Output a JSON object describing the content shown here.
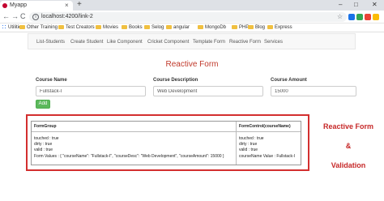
{
  "browser": {
    "tab_title": "Myapp",
    "tab_close": "×",
    "new_tab": "+",
    "window_controls": [
      "–",
      "□",
      "✕"
    ],
    "url": "localhost:4200/link-2",
    "star": "☆",
    "nav": {
      "back": "←",
      "forward": "→",
      "reload": "C"
    },
    "info": "i",
    "extension_colors": [
      "#1a73e8",
      "#34a853",
      "#ea4335",
      "#fbbc04",
      "#5f6368"
    ]
  },
  "bookmarks": [
    "Utilities",
    "Other Training",
    "Test Creators",
    "Movies",
    "Books",
    "Selog",
    "angular",
    "MongoDb",
    "PHP",
    "Blog",
    "Express"
  ],
  "app_nav": [
    "List-Students",
    "Create Student",
    "Like Component",
    "Cricket Component",
    "Template Form",
    "Reactive Form",
    "Services"
  ],
  "form": {
    "title": "Reactive Form",
    "fields": [
      {
        "label": "Course Name",
        "value": "Fullstack-I"
      },
      {
        "label": "Course Description",
        "value": "Web Development"
      },
      {
        "label": "Course Amount",
        "value": "15000"
      }
    ],
    "add_button": "Add"
  },
  "debug_table": {
    "left_header": "FormGroup",
    "right_header": "FormControl(courseName)",
    "left_lines": [
      "touched : true",
      "dirty : true",
      "valid : true",
      "Form Values : { \"courseName\": \"Fullstack-I\", \"courseDesc\": \"Web Development\", \"courseAmount\": 15000 }"
    ],
    "right_lines": [
      "touched : true",
      "dirty : true",
      "valid : true",
      "courseName Value : Fullstack-I"
    ]
  },
  "annotation": {
    "line1": "Reactive Form",
    "line2": "&",
    "line3": "Validation"
  },
  "colors": {
    "accent_red": "#d32f2f",
    "add_button": "#5cb85c",
    "heading": "#c0392b"
  }
}
